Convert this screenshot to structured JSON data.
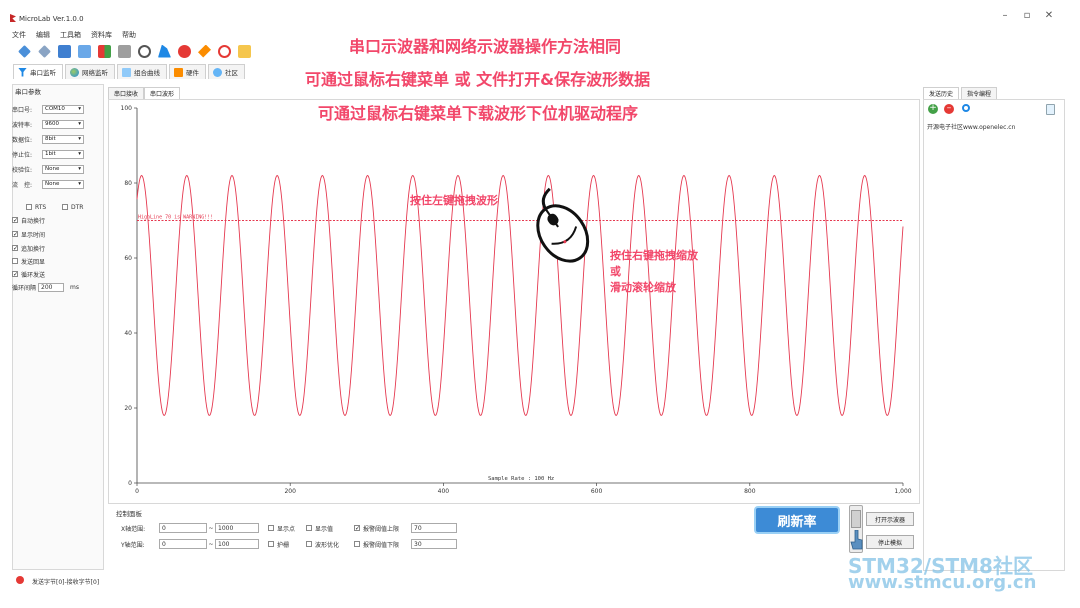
{
  "window": {
    "title": "MicroLab Ver.1.0.0",
    "controls": {
      "minimize": "–",
      "maximize": "▫",
      "close": "✕"
    }
  },
  "menu": [
    "文件",
    "编辑",
    "工具箱",
    "资料库",
    "帮助"
  ],
  "toolbar_icons": [
    "plug-icon",
    "unplug-icon",
    "window-icon",
    "calc-icon",
    "sort-icon",
    "list-icon",
    "glasses-icon",
    "run-icon",
    "brand-icon",
    "key-icon",
    "heart-icon",
    "book-icon"
  ],
  "main_tabs": [
    {
      "label": "串口监听",
      "icon": "funnel-icon"
    },
    {
      "label": "网络监听",
      "icon": "globe-icon"
    },
    {
      "label": "组合曲线",
      "icon": "chart-icon"
    },
    {
      "label": "硬件",
      "icon": "cart-icon"
    },
    {
      "label": "社区",
      "icon": "community-icon"
    }
  ],
  "serial_params": {
    "title": "串口参数",
    "fields": [
      {
        "label": "串口号:",
        "value": "COM10"
      },
      {
        "label": "波特率:",
        "value": "9600"
      },
      {
        "label": "数据位:",
        "value": "8bit"
      },
      {
        "label": "停止位:",
        "value": "1bit"
      },
      {
        "label": "校验位:",
        "value": "None"
      },
      {
        "label": "流　控:",
        "value": "None"
      }
    ],
    "rts": "RTS",
    "dtr": "DTR",
    "options": [
      {
        "label": "自动换行",
        "checked": true
      },
      {
        "label": "显示时间",
        "checked": true
      },
      {
        "label": "追加换行",
        "checked": true
      },
      {
        "label": "发送回显",
        "checked": false
      },
      {
        "label": "循环发送",
        "checked": true
      }
    ],
    "interval_label": "循环间隔",
    "interval_value": "200",
    "interval_unit": "ms"
  },
  "sub_tabs": [
    "串口接收",
    "串口波形"
  ],
  "chart_data": {
    "type": "line",
    "xlim": [
      0,
      1000
    ],
    "ylim": [
      0,
      100
    ],
    "x_ticks": [
      "0",
      "200",
      "400",
      "600",
      "800",
      "1,000"
    ],
    "y_ticks": [
      "0",
      "20",
      "40",
      "60",
      "80",
      "100"
    ],
    "series": [
      {
        "color": "#e53950",
        "amplitude_center": 50,
        "amplitude": 32,
        "period": 59
      }
    ],
    "threshold_line": {
      "y": 70,
      "label": "HighLine 70 is WARNING!!!",
      "color": "#e53950"
    },
    "annotation": "Sample Rate : 100 Hz",
    "grid": false
  },
  "overlay": {
    "line1": "串口示波器和网络示波器操作方法相同",
    "line2": "可通过鼠标右键菜单 或 文件打开&保存波形数据",
    "line3": "可通过鼠标右键菜单下载波形下位机驱动程序",
    "left_drag": "按住左键拖拽波形",
    "right_drag": "按住右键拖拽缩放",
    "or": "或",
    "wheel": "滑动滚轮缩放"
  },
  "control_panel": {
    "title": "控制面板",
    "x_range_label": "X轴范围:",
    "x_min": "0",
    "x_max": "1000",
    "y_range_label": "Y轴范围:",
    "y_min": "0",
    "y_max": "100",
    "tilde": "~",
    "show_points": "显示点",
    "show_values": "显示值",
    "auto_stop": "护栅",
    "wave_opt": "波形优化",
    "alarm_upper_label": "报警阈值上限",
    "alarm_upper": "70",
    "alarm_lower_label": "报警阈值下限",
    "alarm_lower": "30",
    "refresh_rate": "刷新率",
    "open_scope": "打开示波器",
    "stop_sim": "停止模拟"
  },
  "right_panel": {
    "tabs": [
      "发送历史",
      "指令编程"
    ],
    "entry": "开源电子社区www.openelec.cn"
  },
  "status": {
    "text": "发送字节[0]-接收字节[0]"
  },
  "watermark": {
    "line1": "STM32/STM8社区",
    "line2": "www.stmcu.org.cn"
  }
}
